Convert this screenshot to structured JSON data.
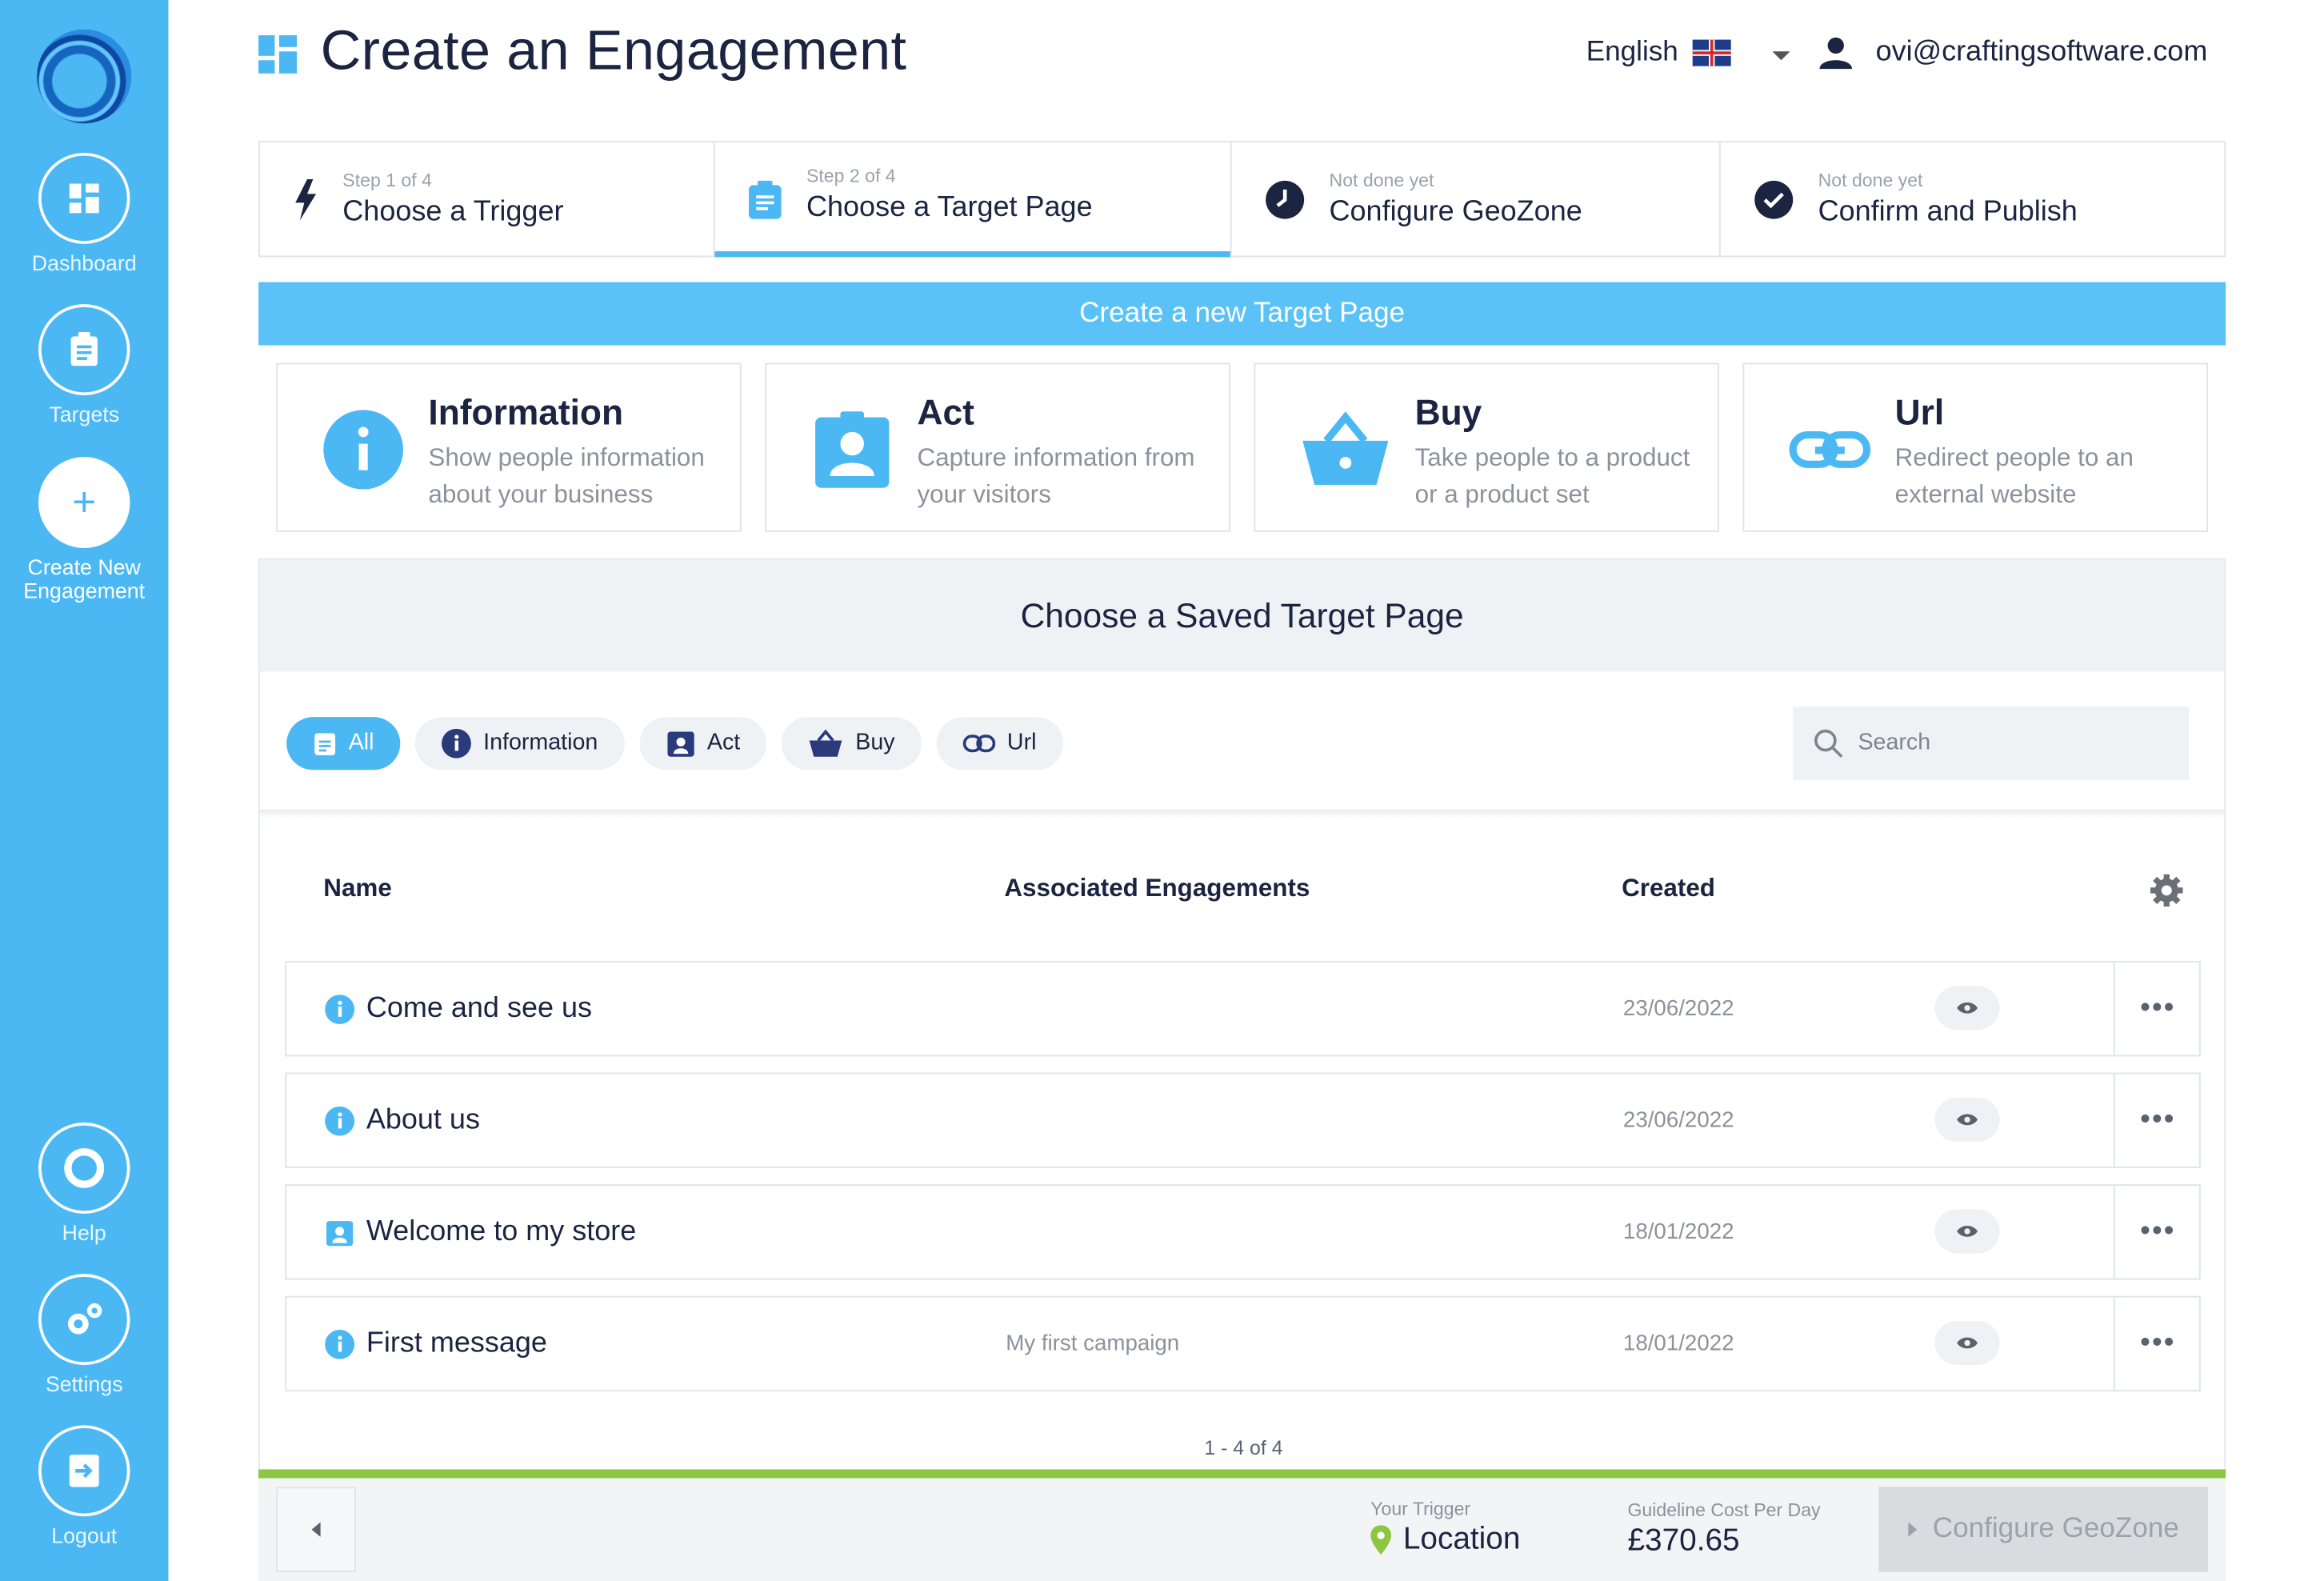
{
  "sidebar": {
    "items": [
      {
        "label": "Dashboard",
        "icon": "dashboard-icon"
      },
      {
        "label": "Targets",
        "icon": "clipboard-icon"
      },
      {
        "label": "Create New Engagement",
        "label_line1": "Create New",
        "label_line2": "Engagement",
        "icon": "plus-icon"
      },
      {
        "label": "Help",
        "icon": "lifebuoy-icon"
      },
      {
        "label": "Settings",
        "icon": "gears-icon"
      },
      {
        "label": "Logout",
        "icon": "logout-icon"
      }
    ]
  },
  "header": {
    "title": "Create an Engagement",
    "language": "English",
    "user_email": "ovi@craftingsoftware.com"
  },
  "steps": [
    {
      "small": "Step 1 of 4",
      "label": "Choose a Trigger",
      "icon": "bolt-icon"
    },
    {
      "small": "Step 2 of 4",
      "label": "Choose a Target Page",
      "icon": "clipboard-icon"
    },
    {
      "small": "Not done yet",
      "label": "Configure GeoZone",
      "icon": "clock-icon"
    },
    {
      "small": "Not done yet",
      "label": "Confirm and Publish",
      "icon": "check-circle-icon"
    }
  ],
  "create_new_label": "Create a new Target Page",
  "target_types": [
    {
      "title": "Information",
      "line1": "Show people information",
      "line2": "about your business",
      "icon": "info-icon"
    },
    {
      "title": "Act",
      "line1": "Capture information from",
      "line2": "your visitors",
      "icon": "contact-badge-icon"
    },
    {
      "title": "Buy",
      "line1": "Take people to a product",
      "line2": "or a product set",
      "icon": "basket-icon"
    },
    {
      "title": "Url",
      "line1": "Redirect people to an",
      "line2": "external website",
      "icon": "link-icon"
    }
  ],
  "saved": {
    "heading": "Choose a Saved Target Page",
    "filters": [
      "All",
      "Information",
      "Act",
      "Buy",
      "Url"
    ],
    "search_placeholder": "Search",
    "columns": [
      "Name",
      "Associated Engagements",
      "Created"
    ],
    "rows": [
      {
        "name": "Come and see us",
        "type": "info-icon",
        "engagements": "",
        "created": "23/06/2022"
      },
      {
        "name": "About us",
        "type": "info-icon",
        "engagements": "",
        "created": "23/06/2022"
      },
      {
        "name": "Welcome to my store",
        "type": "contact-badge-icon",
        "engagements": "",
        "created": "18/01/2022"
      },
      {
        "name": "First message",
        "type": "info-icon",
        "engagements": "My first campaign",
        "created": "18/01/2022"
      }
    ],
    "pagination": "1 - 4 of 4"
  },
  "footer": {
    "trigger_label": "Your Trigger",
    "trigger_value": "Location",
    "cost_label": "Guideline Cost Per Day",
    "cost_value": "£370.65",
    "next_label": "Configure GeoZone"
  },
  "colors": {
    "accent": "#4bb8f3",
    "navy": "#1b2440",
    "progress": "#8dc640"
  }
}
